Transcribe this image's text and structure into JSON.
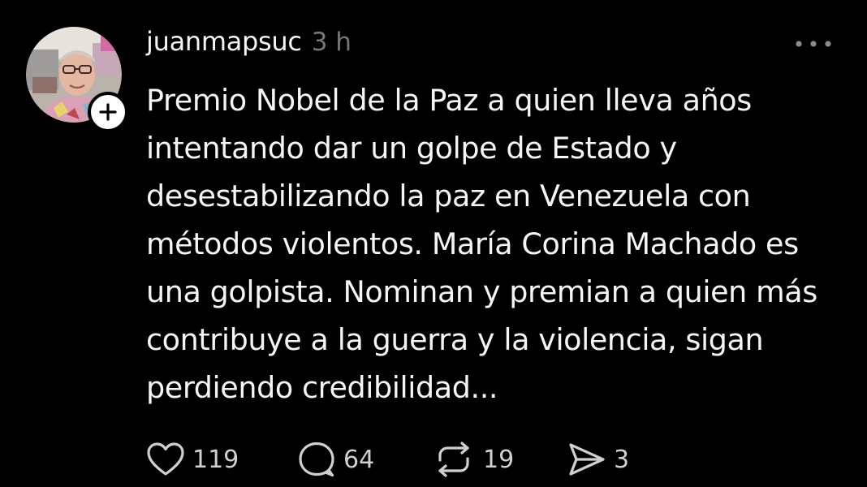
{
  "post": {
    "username": "juanmapsuc",
    "timestamp": "3 h",
    "body_lines": [
      "Premio Nobel de la Paz a quien lleva años",
      "intentando dar un golpe de Estado y",
      "desestabilizando la paz en Venezuela con",
      "métodos violentos. María Corina Machado es",
      "una golpista. Nominan y premian a quien más",
      "contribuye a la guerra y la violencia, sigan",
      "perdiendo credibilidad..."
    ],
    "actions": {
      "like_count": "119",
      "reply_count": "64",
      "repost_count": "19",
      "share_count": "3"
    },
    "icons": {
      "avatar": "profile-photo",
      "follow": "plus-icon",
      "more": "more-horizontal-icon",
      "like": "heart-icon",
      "reply": "speech-bubble-icon",
      "repost": "repost-arrows-icon",
      "share": "send-icon"
    }
  },
  "colors": {
    "background": "#000000",
    "text_primary": "#f3f5f7",
    "text_secondary": "#777777",
    "icon": "#d0d0d0"
  }
}
